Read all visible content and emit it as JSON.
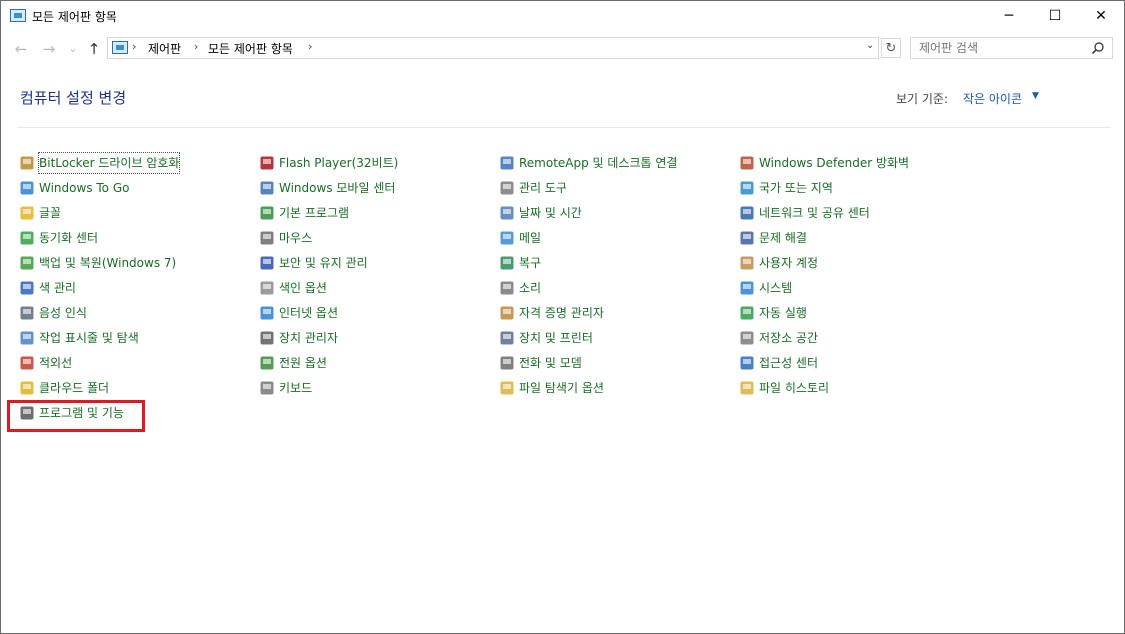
{
  "window": {
    "title": "모든 제어판 항목"
  },
  "window_controls": {
    "minimize": "─",
    "maximize": "☐",
    "close": "✕"
  },
  "nav": {
    "back": "←",
    "forward": "→",
    "recent": "⌄",
    "up": "↑"
  },
  "address": {
    "crumbs": [
      "제어판",
      "모든 제어판 항목"
    ],
    "separator": "›",
    "dropdown": "⌄"
  },
  "refresh": "↻",
  "search": {
    "placeholder": "제어판 검색"
  },
  "header": {
    "title": "컴퓨터 설정 변경",
    "view_by_label": "보기 기준:",
    "view_by_value": "작은 아이콘",
    "view_caret": "▼"
  },
  "items": {
    "col1": [
      {
        "label": "BitLocker 드라이브 암호화",
        "icon": "bitlocker-icon"
      },
      {
        "label": "Windows To Go",
        "icon": "windows-to-go-icon"
      },
      {
        "label": "글꼴",
        "icon": "fonts-icon"
      },
      {
        "label": "동기화 센터",
        "icon": "sync-center-icon"
      },
      {
        "label": "백업 및 복원(Windows 7)",
        "icon": "backup-restore-icon"
      },
      {
        "label": "색 관리",
        "icon": "color-management-icon"
      },
      {
        "label": "음성 인식",
        "icon": "speech-recognition-icon"
      },
      {
        "label": "작업 표시줄 및 탐색",
        "icon": "taskbar-icon"
      },
      {
        "label": "적외선",
        "icon": "infrared-icon"
      },
      {
        "label": "클라우드 폴더",
        "icon": "cloud-folder-icon"
      },
      {
        "label": "프로그램 및 기능",
        "icon": "programs-features-icon"
      }
    ],
    "col2": [
      {
        "label": "Flash Player(32비트)",
        "icon": "flash-player-icon"
      },
      {
        "label": "Windows 모바일 센터",
        "icon": "mobility-center-icon"
      },
      {
        "label": "기본 프로그램",
        "icon": "default-programs-icon"
      },
      {
        "label": "마우스",
        "icon": "mouse-icon"
      },
      {
        "label": "보안 및 유지 관리",
        "icon": "security-maintenance-icon"
      },
      {
        "label": "색인 옵션",
        "icon": "indexing-options-icon"
      },
      {
        "label": "인터넷 옵션",
        "icon": "internet-options-icon"
      },
      {
        "label": "장치 관리자",
        "icon": "device-manager-icon"
      },
      {
        "label": "전원 옵션",
        "icon": "power-options-icon"
      },
      {
        "label": "키보드",
        "icon": "keyboard-icon"
      }
    ],
    "col3": [
      {
        "label": "RemoteApp 및 데스크톱 연결",
        "icon": "remoteapp-icon"
      },
      {
        "label": "관리 도구",
        "icon": "admin-tools-icon"
      },
      {
        "label": "날짜 및 시간",
        "icon": "date-time-icon"
      },
      {
        "label": "메일",
        "icon": "mail-icon"
      },
      {
        "label": "복구",
        "icon": "recovery-icon"
      },
      {
        "label": "소리",
        "icon": "sound-icon"
      },
      {
        "label": "자격 증명 관리자",
        "icon": "credential-manager-icon"
      },
      {
        "label": "장치 및 프린터",
        "icon": "devices-printers-icon"
      },
      {
        "label": "전화 및 모뎀",
        "icon": "phone-modem-icon"
      },
      {
        "label": "파일 탐색기 옵션",
        "icon": "file-explorer-options-icon"
      }
    ],
    "col4": [
      {
        "label": "Windows Defender 방화벽",
        "icon": "firewall-icon"
      },
      {
        "label": "국가 또는 지역",
        "icon": "region-icon"
      },
      {
        "label": "네트워크 및 공유 센터",
        "icon": "network-sharing-icon"
      },
      {
        "label": "문제 해결",
        "icon": "troubleshooting-icon"
      },
      {
        "label": "사용자 계정",
        "icon": "user-accounts-icon"
      },
      {
        "label": "시스템",
        "icon": "system-icon"
      },
      {
        "label": "자동 실행",
        "icon": "autoplay-icon"
      },
      {
        "label": "저장소 공간",
        "icon": "storage-spaces-icon"
      },
      {
        "label": "접근성 센터",
        "icon": "ease-of-access-icon"
      },
      {
        "label": "파일 히스토리",
        "icon": "file-history-icon"
      }
    ]
  },
  "colors": {
    "link_green": "#1a6c25",
    "title_blue": "#1e3287",
    "highlight_red": "#e01a22"
  }
}
